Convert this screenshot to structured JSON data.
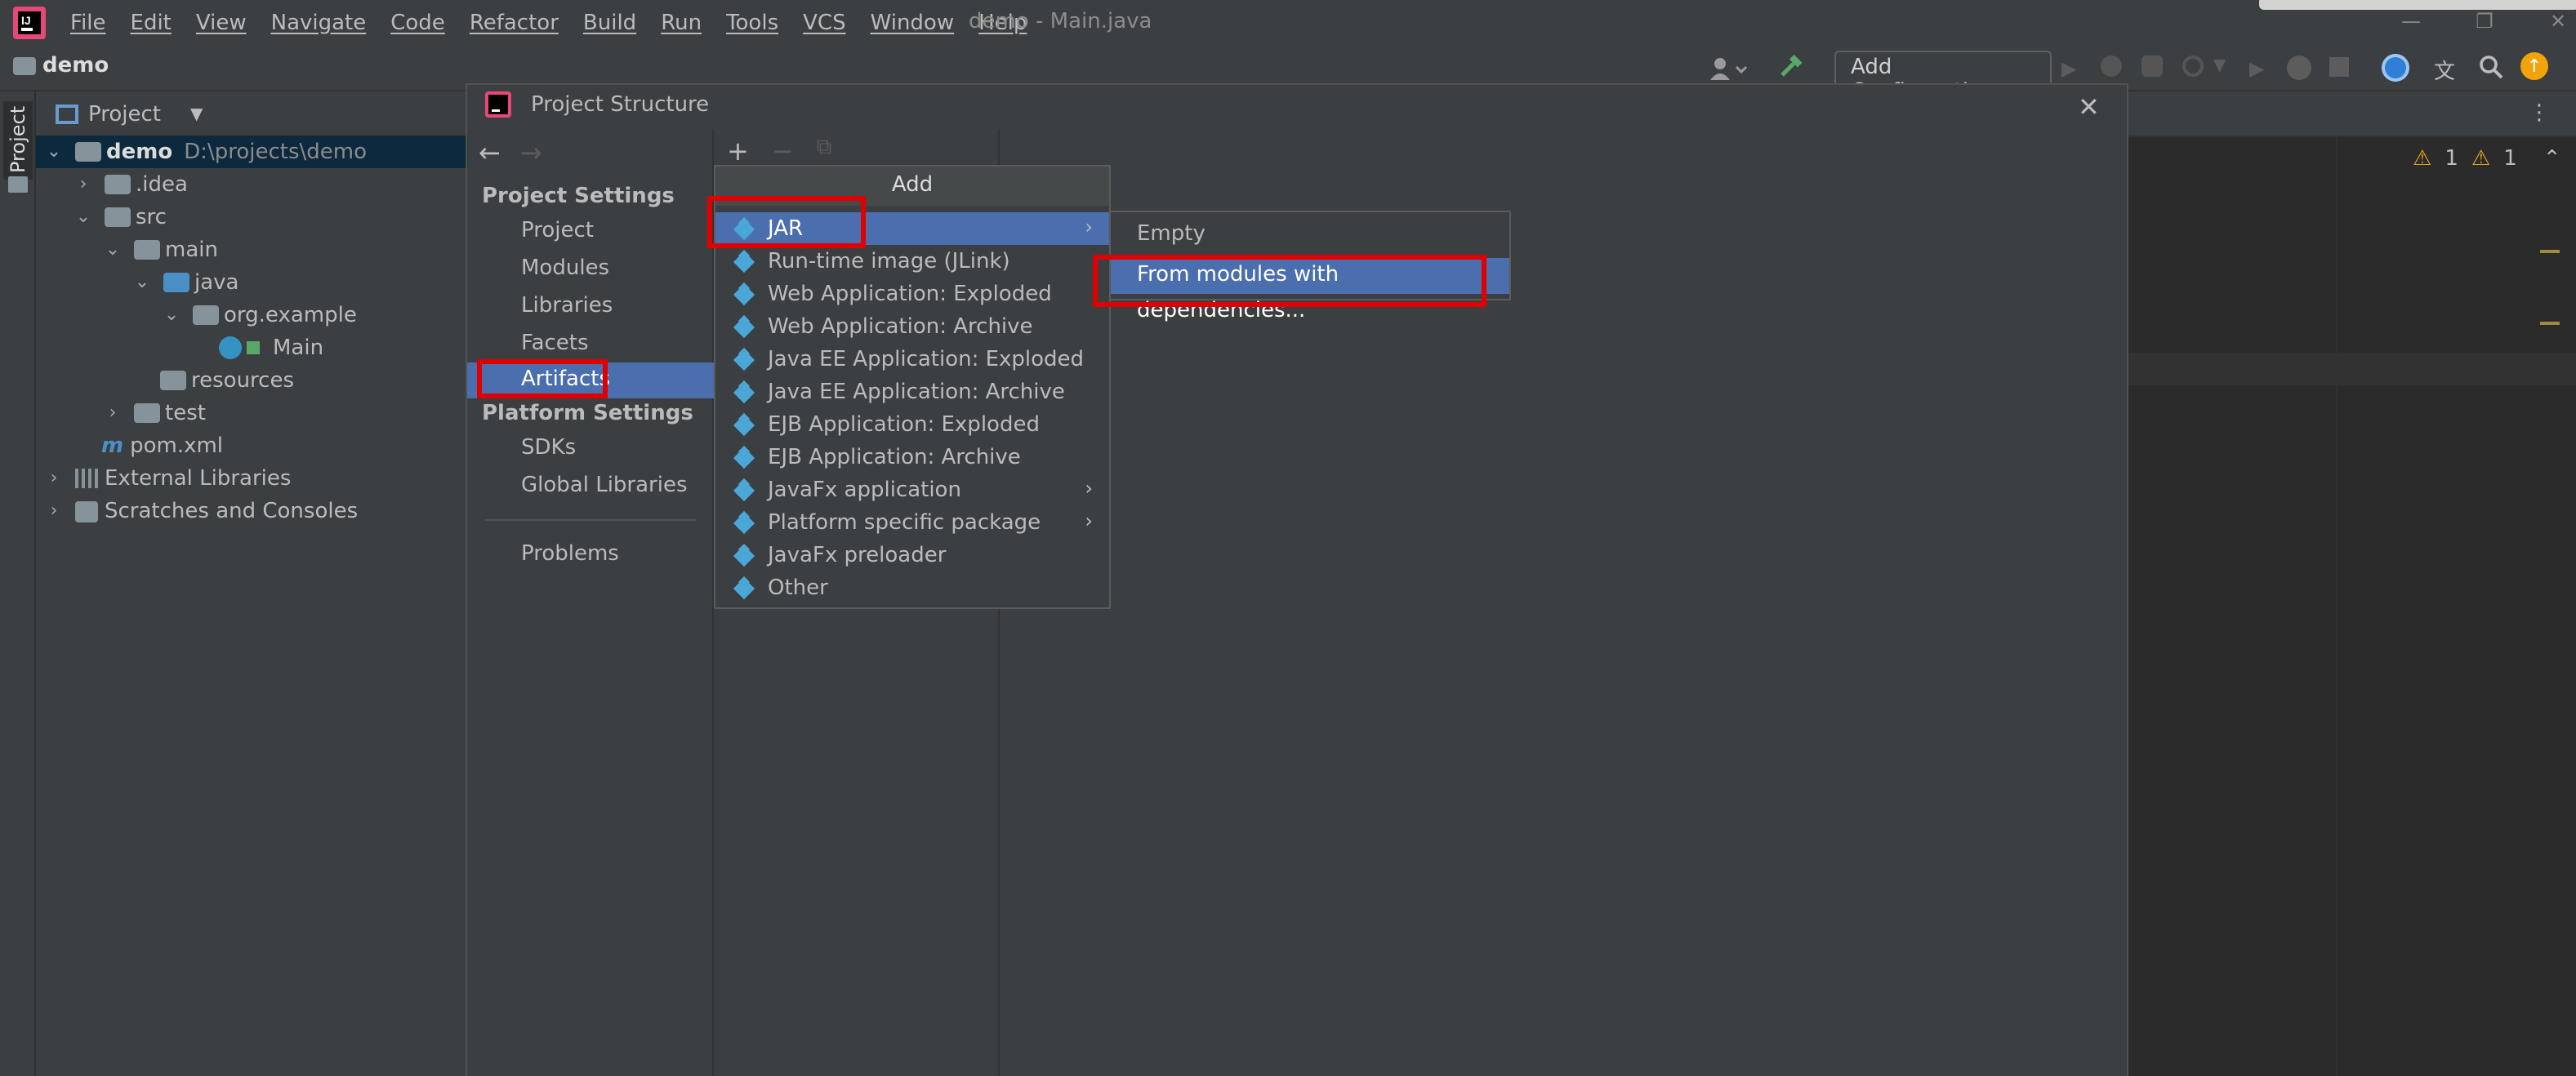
{
  "menubar": {
    "items": [
      "File",
      "Edit",
      "View",
      "Navigate",
      "Code",
      "Refactor",
      "Build",
      "Run",
      "Tools",
      "VCS",
      "Window",
      "Help"
    ],
    "window_title": "demo - Main.java"
  },
  "navbar": {
    "breadcrumb": "demo",
    "run_config": "Add Configuration..."
  },
  "toolwindow": {
    "side_label": "Project",
    "header": "Project"
  },
  "tree": {
    "items": [
      {
        "label": "demo",
        "extra": "D:\\projects\\demo"
      },
      {
        "label": ".idea"
      },
      {
        "label": "src"
      },
      {
        "label": "main"
      },
      {
        "label": "java"
      },
      {
        "label": "org.example"
      },
      {
        "label": "Main"
      },
      {
        "label": "resources"
      },
      {
        "label": "test"
      },
      {
        "label": "pom.xml"
      },
      {
        "label": "External Libraries"
      },
      {
        "label": "Scratches and Consoles"
      }
    ]
  },
  "editor": {
    "warning_count_1": "1",
    "warning_count_2": "1"
  },
  "dialog": {
    "title": "Project Structure",
    "project_settings_title": "Project Settings",
    "project_settings": [
      "Project",
      "Modules",
      "Libraries",
      "Facets",
      "Artifacts"
    ],
    "platform_settings_title": "Platform Settings",
    "platform_settings": [
      "SDKs",
      "Global Libraries"
    ],
    "problems": "Problems",
    "selected": "Artifacts"
  },
  "add_popup": {
    "title": "Add",
    "items": [
      {
        "label": "JAR",
        "submenu": true
      },
      {
        "label": "Run-time image (JLink)"
      },
      {
        "label": "Web Application: Exploded"
      },
      {
        "label": "Web Application: Archive"
      },
      {
        "label": "Java EE Application: Exploded"
      },
      {
        "label": "Java EE Application: Archive"
      },
      {
        "label": "EJB Application: Exploded"
      },
      {
        "label": "EJB Application: Archive"
      },
      {
        "label": "JavaFx application",
        "submenu": true
      },
      {
        "label": "Platform specific package",
        "submenu": true
      },
      {
        "label": "JavaFx preloader"
      },
      {
        "label": "Other"
      }
    ]
  },
  "jar_submenu": {
    "items": [
      "Empty",
      "From modules with dependencies..."
    ]
  },
  "colors": {
    "selection": "#4b6eaf",
    "highlight_box": "#e00000",
    "panel": "#3c3f41",
    "editor": "#2b2b2b"
  }
}
